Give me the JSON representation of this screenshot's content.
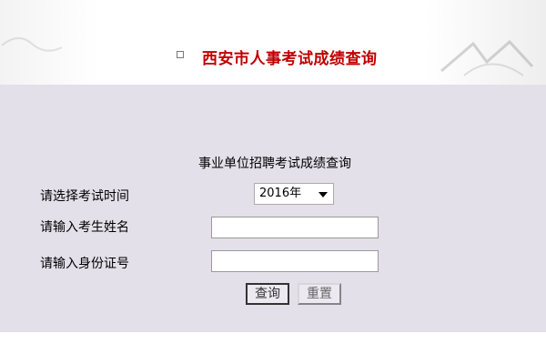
{
  "header": {
    "title": "西安市人事考试成绩查询",
    "icon": "checkbox-icon"
  },
  "form": {
    "title": "事业单位招聘考试成绩查询",
    "exam_time_label": "请选择考试时间",
    "exam_time_value": "2016年",
    "name_label": "请输入考生姓名",
    "name_value": "",
    "id_label": "请输入身份证号",
    "id_value": "",
    "query_button": "查询",
    "reset_button": "重置"
  },
  "colors": {
    "title_red": "#c00000",
    "panel_bg": "#e3e0e9"
  }
}
